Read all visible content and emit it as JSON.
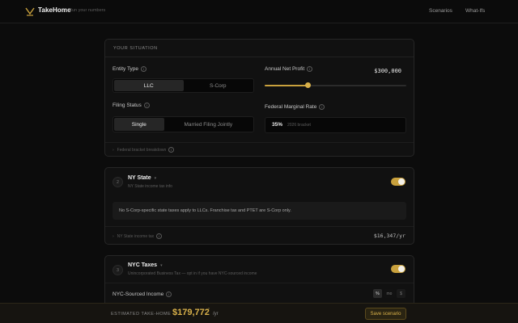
{
  "header": {
    "brand": "TakeHome",
    "tagline": "Run your numbers",
    "nav": [
      "Scenarios",
      "What-Ifs"
    ]
  },
  "situation": {
    "title": "YOUR SITUATION",
    "entity_label": "Entity Type",
    "entity_options": [
      "LLC",
      "S-Corp"
    ],
    "entity_selected": "LLC",
    "profit_label": "Annual Net Profit",
    "profit_value": "$300,000",
    "profit_slider_fraction": 0.303,
    "filing_label": "Filing Status",
    "filing_options": [
      "Single",
      "Married Filing Jointly"
    ],
    "filing_selected": "Single",
    "rate_label": "Federal Marginal Rate",
    "rate_value": "35%",
    "rate_note": "2026 bracket",
    "footer_note": "Federal bracket breakdown"
  },
  "ny_state": {
    "number": "2",
    "title": "NY State",
    "subtitle": "NY State income tax info",
    "enabled": true,
    "notice": "No S-Corp-specific state taxes apply to LLCs. Franchise tax and PTET are S-Corp only.",
    "tax_label": "NY State income tax",
    "tax_value": "$16,347/yr"
  },
  "nyc": {
    "number": "3",
    "title": "NYC Taxes",
    "subtitle": "Unincorporated Business Tax — opt in if you have NYC-sourced income",
    "enabled": true,
    "income_label": "NYC-Sourced Income",
    "unit_pct": "%",
    "unit_alt": "mo",
    "unit_more": "$"
  },
  "bottom": {
    "est_label": "ESTIMATED TAKE-HOME",
    "est_value": "$179,772",
    "est_sup": "*",
    "est_unit": "/yr",
    "save_label": "Save scenario"
  },
  "colors": {
    "accent": "#c9a13d",
    "background": "#0c0c0c",
    "card": "#111111"
  }
}
